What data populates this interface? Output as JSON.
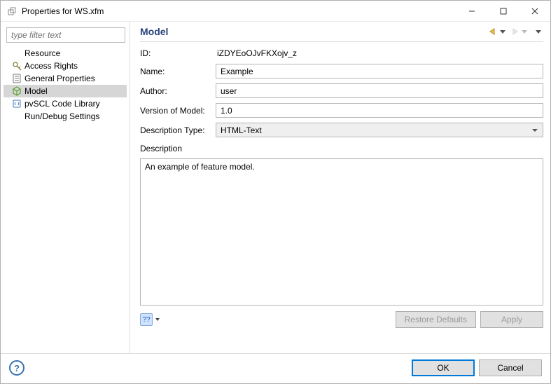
{
  "window": {
    "title": "Properties for WS.xfm"
  },
  "sidebar": {
    "filter_placeholder": "type filter text",
    "items": [
      {
        "label": "Resource",
        "icon": "none",
        "selected": false
      },
      {
        "label": "Access Rights",
        "icon": "access",
        "selected": false
      },
      {
        "label": "General Properties",
        "icon": "general",
        "selected": false
      },
      {
        "label": "Model",
        "icon": "model",
        "selected": true
      },
      {
        "label": "pvSCL Code Library",
        "icon": "code",
        "selected": false
      },
      {
        "label": "Run/Debug Settings",
        "icon": "none",
        "selected": false
      }
    ]
  },
  "header": {
    "title": "Model"
  },
  "form": {
    "id_label": "ID:",
    "id_value": "iZDYEoOJvFKXojv_z",
    "name_label": "Name:",
    "name_value": "Example",
    "author_label": "Author:",
    "author_value": "user",
    "version_label": "Version of Model:",
    "version_value": "1.0",
    "desc_type_label": "Description Type:",
    "desc_type_value": "HTML-Text",
    "desc_label": "Description",
    "desc_value": "An example of feature model."
  },
  "buttons": {
    "restore_defaults": "Restore Defaults",
    "apply": "Apply",
    "ok": "OK",
    "cancel": "Cancel",
    "help_small": "??"
  }
}
